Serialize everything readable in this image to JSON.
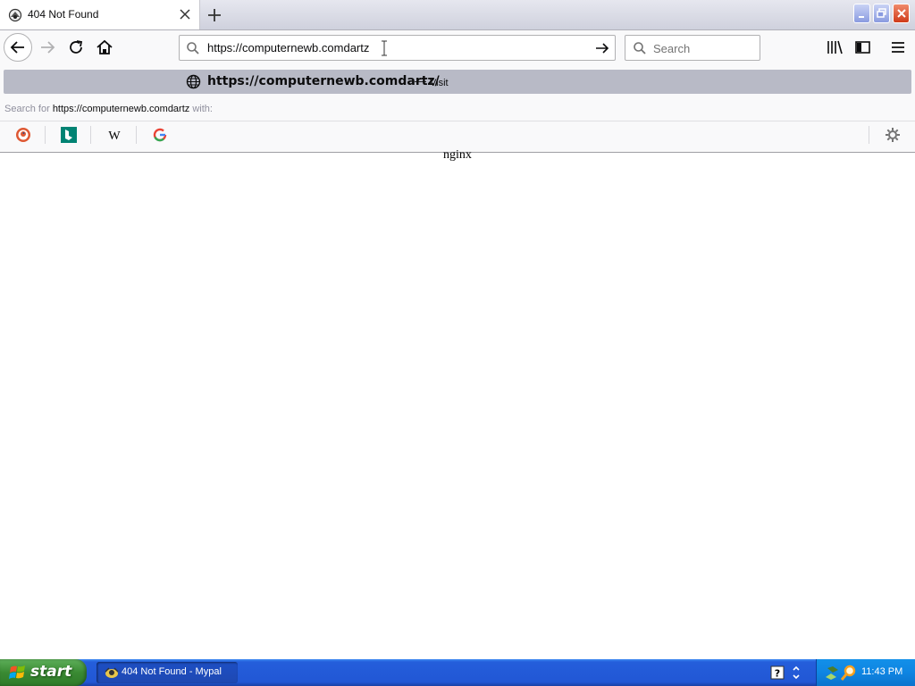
{
  "tab": {
    "title": "404 Not Found"
  },
  "window": {
    "controls": [
      "minimize",
      "restore",
      "close"
    ]
  },
  "urlbar": {
    "value": "https://computernewb.comdartz"
  },
  "searchbar": {
    "placeholder": "Search"
  },
  "dropdown": {
    "suggestion_url": "https://computernewb.comdartz/",
    "suggestion_dash": "—",
    "suggestion_action": "Visit",
    "search_for_prefix": "Search for ",
    "search_for_term": "https://computernewb.comdartz",
    "search_for_suffix": " with:",
    "engines": [
      "duckduckgo-icon",
      "bing-icon",
      "wikipedia-icon",
      "google-icon"
    ]
  },
  "content": {
    "text": "nginx"
  },
  "taskbar": {
    "start_label": "start",
    "task_label": "404 Not Found - Mypal",
    "clock": "11:43 PM"
  },
  "colors": {
    "taskbar_blue": "#245edb",
    "start_green": "#3a8a33",
    "tray_blue": "#0f85e2"
  }
}
